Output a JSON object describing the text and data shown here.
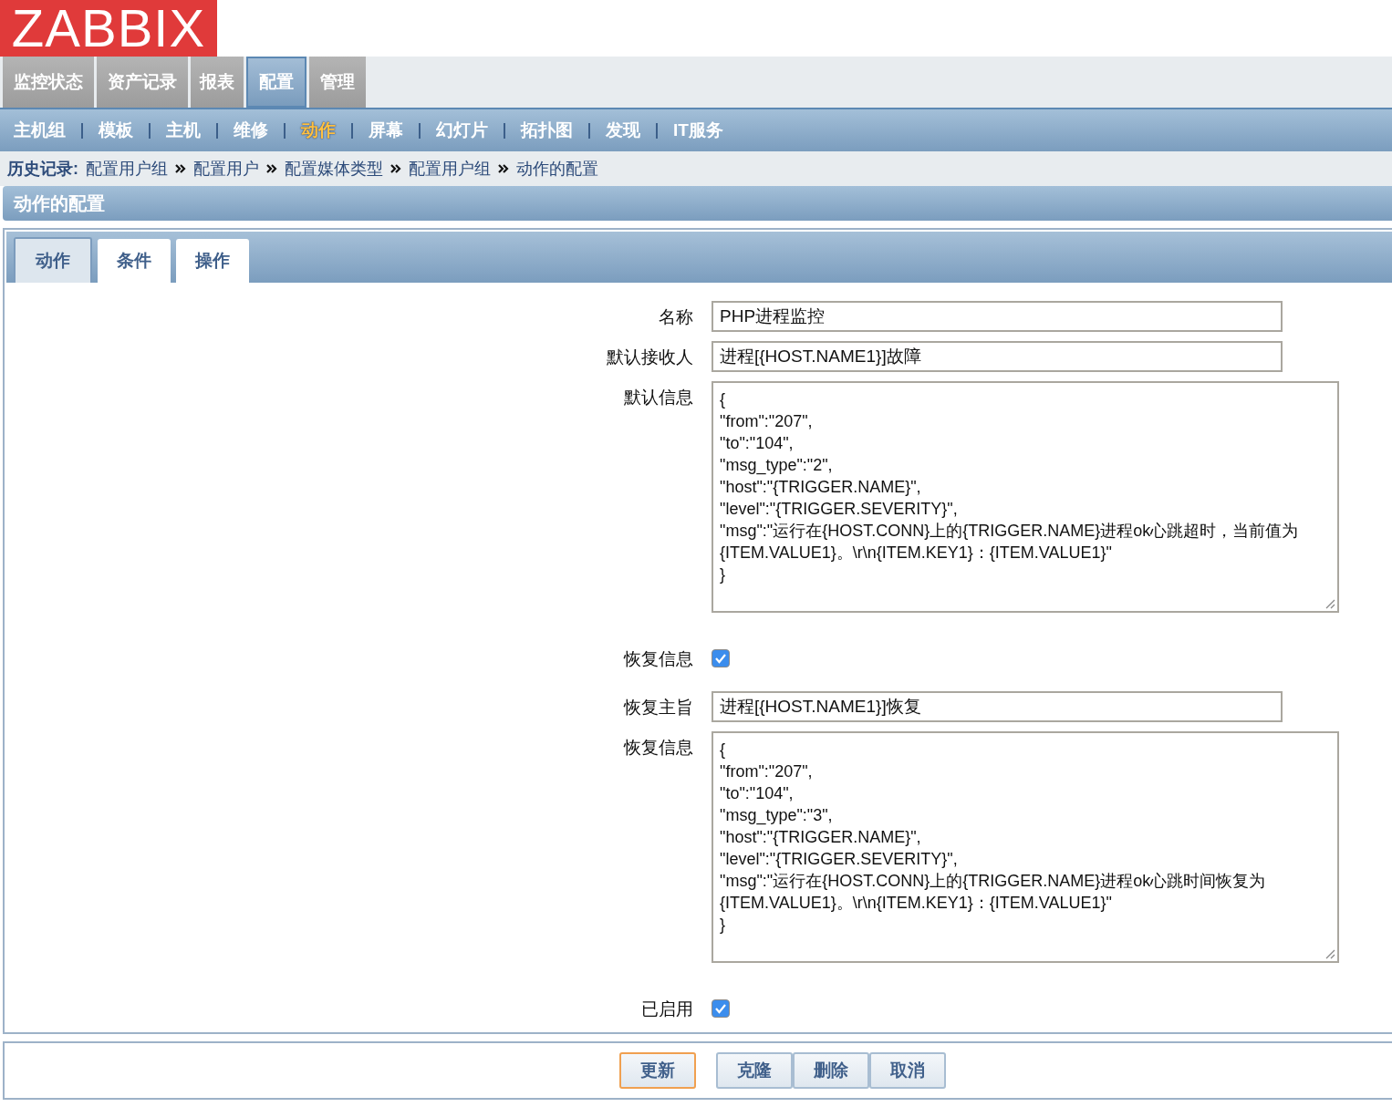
{
  "logo": "ZABBIX",
  "main_menu": [
    {
      "label": "监控状态",
      "selected": false
    },
    {
      "label": "资产记录",
      "selected": false
    },
    {
      "label": "报表",
      "selected": false
    },
    {
      "label": "配置",
      "selected": true
    },
    {
      "label": "管理",
      "selected": false
    }
  ],
  "sub_menu": [
    {
      "label": "主机组",
      "selected": false
    },
    {
      "label": "模板",
      "selected": false
    },
    {
      "label": "主机",
      "selected": false
    },
    {
      "label": "维修",
      "selected": false
    },
    {
      "label": "动作",
      "selected": true
    },
    {
      "label": "屏幕",
      "selected": false
    },
    {
      "label": "幻灯片",
      "selected": false
    },
    {
      "label": "拓扑图",
      "selected": false
    },
    {
      "label": "发现",
      "selected": false
    },
    {
      "label": "IT服务",
      "selected": false
    }
  ],
  "history": {
    "label": "历史记录:",
    "items": [
      "配置用户组",
      "配置用户",
      "配置媒体类型",
      "配置用户组",
      "动作的配置"
    ]
  },
  "page_title": "动作的配置",
  "tabs": [
    {
      "label": "动作",
      "selected": true
    },
    {
      "label": "条件",
      "selected": false
    },
    {
      "label": "操作",
      "selected": false
    }
  ],
  "form": [
    {
      "kind": "text",
      "label": "名称",
      "value": "PHP进程监控"
    },
    {
      "kind": "text",
      "label": "默认接收人",
      "value": "进程[{HOST.NAME1}]故障"
    },
    {
      "kind": "textarea",
      "label": "默认信息",
      "value": "{\n\"from\":\"207\",\n\"to\":\"104\",\n\"msg_type\":\"2\",\n\"host\":\"{TRIGGER.NAME}\",\n\"level\":\"{TRIGGER.SEVERITY}\",\n\"msg\":\"运行在{HOST.CONN}上的{TRIGGER.NAME}进程ok心跳超时，当前值为 {ITEM.VALUE1}。\\r\\n{ITEM.KEY1}：{ITEM.VALUE1}\"\n}"
    },
    {
      "kind": "checkbox",
      "label": "恢复信息",
      "checked": true
    },
    {
      "kind": "text",
      "label": "恢复主旨",
      "value": "进程[{HOST.NAME1}]恢复"
    },
    {
      "kind": "textarea",
      "label": "恢复信息",
      "value": "{\n\"from\":\"207\",\n\"to\":\"104\",\n\"msg_type\":\"3\",\n\"host\":\"{TRIGGER.NAME}\",\n\"level\":\"{TRIGGER.SEVERITY}\",\n\"msg\":\"运行在{HOST.CONN}上的{TRIGGER.NAME}进程ok心跳时间恢复为 {ITEM.VALUE1}。\\r\\n{ITEM.KEY1}：{ITEM.VALUE1}\"\n}"
    },
    {
      "kind": "checkbox",
      "label": "已启用",
      "checked": true
    }
  ],
  "buttons": [
    {
      "label": "更新",
      "primary": true
    },
    {
      "label": "克隆",
      "primary": false
    },
    {
      "label": "删除",
      "primary": false
    },
    {
      "label": "取消",
      "primary": false
    }
  ]
}
